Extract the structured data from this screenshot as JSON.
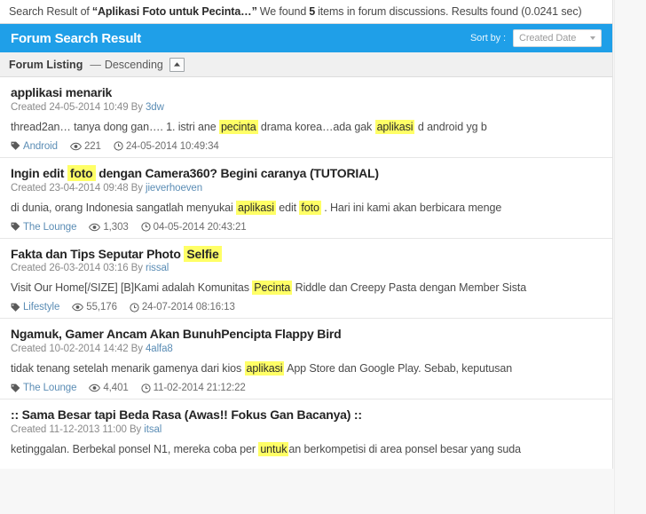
{
  "summary": {
    "prefix": "Search Result of",
    "query": "“Aplikasi Foto untuk Pecinta…”",
    "middle": "We found",
    "count": "5",
    "suffix": "items in forum discussions. Results found (0.0241 sec)"
  },
  "header": {
    "title": "Forum Search Result",
    "sort_label": "Sort by :",
    "sort_value": "Created Date",
    "caret_icon": "chevron-down-icon"
  },
  "listing": {
    "label": "Forum Listing",
    "dash": "—",
    "order": "Descending",
    "toggle_icon": "caret-up-box-icon"
  },
  "icons": {
    "tag": "tag-icon",
    "views": "eye-icon",
    "time": "clock-icon"
  },
  "results": [
    {
      "title_parts": [
        {
          "text": "applikasi menarik",
          "hl": false
        }
      ],
      "created_prefix": "Created",
      "created": "24-05-2014 10:49",
      "by_label": "By",
      "author": "3dw",
      "snippet_parts": [
        {
          "text": "thread2an… tanya dong gan…. 1. istri ane ",
          "hl": false
        },
        {
          "text": "pecinta",
          "hl": true
        },
        {
          "text": " drama korea…ada gak ",
          "hl": false
        },
        {
          "text": "aplikasi",
          "hl": true
        },
        {
          "text": " d android yg b",
          "hl": false
        }
      ],
      "category": "Android",
      "views": "221",
      "timestamp": "24-05-2014 10:49:34"
    },
    {
      "title_parts": [
        {
          "text": "Ingin edit ",
          "hl": false
        },
        {
          "text": "foto",
          "hl": true
        },
        {
          "text": " dengan Camera360? Begini caranya (TUTORIAL)",
          "hl": false
        }
      ],
      "created_prefix": "Created",
      "created": "23-04-2014 09:48",
      "by_label": "By",
      "author": "jieverhoeven",
      "snippet_parts": [
        {
          "text": "di dunia, orang Indonesia sangatlah menyukai ",
          "hl": false
        },
        {
          "text": "aplikasi",
          "hl": true
        },
        {
          "text": " edit ",
          "hl": false
        },
        {
          "text": "foto",
          "hl": true
        },
        {
          "text": " . Hari ini kami akan berbicara menge",
          "hl": false
        }
      ],
      "category": "The Lounge",
      "views": "1,303",
      "timestamp": "04-05-2014 20:43:21"
    },
    {
      "title_parts": [
        {
          "text": "Fakta dan Tips Seputar Photo ",
          "hl": false
        },
        {
          "text": "Selfie",
          "hl": true
        }
      ],
      "created_prefix": "Created",
      "created": "26-03-2014 03:16",
      "by_label": "By",
      "author": "rissal",
      "snippet_parts": [
        {
          "text": "Visit Our Home[/SIZE] [B]Kami adalah Komunitas ",
          "hl": false
        },
        {
          "text": "Pecinta",
          "hl": true
        },
        {
          "text": " Riddle dan Creepy Pasta dengan Member Sista",
          "hl": false
        }
      ],
      "category": "Lifestyle",
      "views": "55,176",
      "timestamp": "24-07-2014 08:16:13"
    },
    {
      "title_parts": [
        {
          "text": "Ngamuk, Gamer Ancam Akan BunuhPencipta Flappy Bird",
          "hl": false
        }
      ],
      "created_prefix": "Created",
      "created": "10-02-2014 14:42",
      "by_label": "By",
      "author": "4alfa8",
      "snippet_parts": [
        {
          "text": "tidak tenang setelah menarik gamenya dari kios ",
          "hl": false
        },
        {
          "text": "aplikasi",
          "hl": true
        },
        {
          "text": " App Store dan Google Play. Sebab, keputusan",
          "hl": false
        }
      ],
      "category": "The Lounge",
      "views": "4,401",
      "timestamp": "11-02-2014 21:12:22"
    },
    {
      "title_parts": [
        {
          "text": ":: Sama Besar tapi Beda Rasa (Awas!! Fokus Gan Bacanya) ::",
          "hl": false
        }
      ],
      "created_prefix": "Created",
      "created": "11-12-2013 11:00",
      "by_label": "By",
      "author": "itsal",
      "snippet_parts": [
        {
          "text": "ketinggalan. Berbekal ponsel N1, mereka coba per ",
          "hl": false
        },
        {
          "text": "untuk",
          "hl": true
        },
        {
          "text": "an berkompetisi di area ponsel besar yang suda",
          "hl": false
        }
      ],
      "category": "",
      "views": "",
      "timestamp": ""
    }
  ],
  "colors": {
    "accent_blue": "#1f9fe8",
    "highlight_yellow": "#ffff66",
    "link_blue": "#5b8db5"
  }
}
